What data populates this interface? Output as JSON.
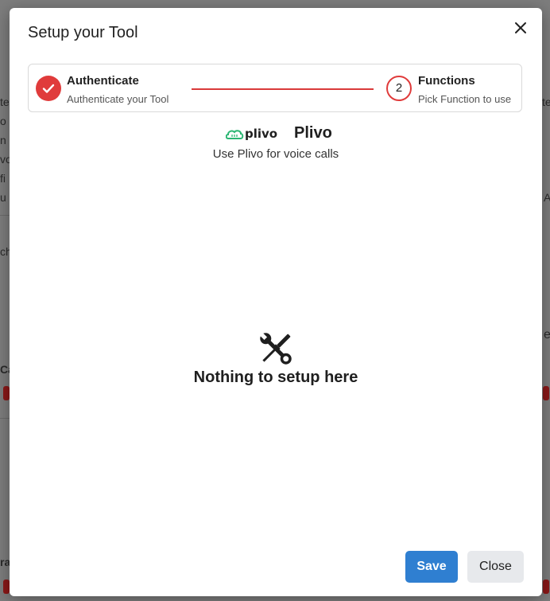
{
  "background": {
    "fragments": [
      "te",
      "o",
      "n",
      "vo",
      "fi",
      "u",
      "ch",
      "Ca",
      "ra",
      "te",
      "e",
      "A",
      "e",
      "nL"
    ]
  },
  "modal": {
    "title": "Setup your Tool",
    "close_icon": "close-icon",
    "stepper": {
      "steps": [
        {
          "title": "Authenticate",
          "subtitle": "Authenticate your Tool",
          "status": "complete"
        },
        {
          "number": "2",
          "title": "Functions",
          "subtitle": "Pick Function to use",
          "status": "current"
        }
      ],
      "accent_color": "#e03b3b"
    },
    "tool": {
      "logo_text": "plivo",
      "name": "Plivo",
      "description": "Use Plivo for voice calls",
      "logo_color": "#2bb673"
    },
    "empty_state": {
      "icon": "wrench-screwdriver-icon",
      "message": "Nothing to setup here"
    },
    "buttons": {
      "save": "Save",
      "close": "Close"
    }
  }
}
